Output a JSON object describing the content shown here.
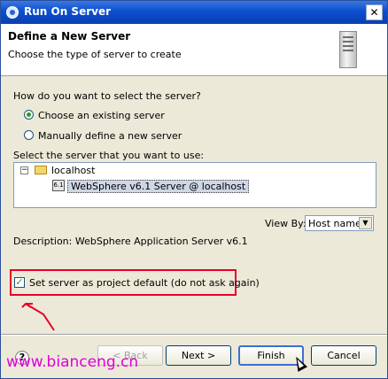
{
  "window": {
    "title": "Run On Server",
    "close_glyph": "✕"
  },
  "banner": {
    "heading": "Define a New Server",
    "subtitle": "Choose the type of server to create",
    "icon": "server-tower-icon"
  },
  "selection": {
    "question": "How do you want to select the server?",
    "options": [
      {
        "label": "Choose an existing server",
        "selected": true
      },
      {
        "label": "Manually define a new server",
        "selected": false
      }
    ],
    "list_label": "Select the server that you want to use:"
  },
  "tree": {
    "root_label": "localhost",
    "child_label": "WebSphere v6.1 Server @ localhost",
    "child_icon_text": "6.1"
  },
  "view_by": {
    "label": "View By:",
    "value": "Host name"
  },
  "description": "Description: WebSphere Application Server v6.1",
  "default_checkbox": {
    "label": "Set server as project default (do not ask again)",
    "checked": true
  },
  "buttons": {
    "help": "?",
    "back": "< Back",
    "next": "Next >",
    "finish": "Finish",
    "cancel": "Cancel"
  },
  "watermark": "www.bianceng.cn",
  "colors": {
    "annotation_red": "#e8002a",
    "watermark": "#e000d8",
    "titlebar": "#0b4fd0"
  }
}
